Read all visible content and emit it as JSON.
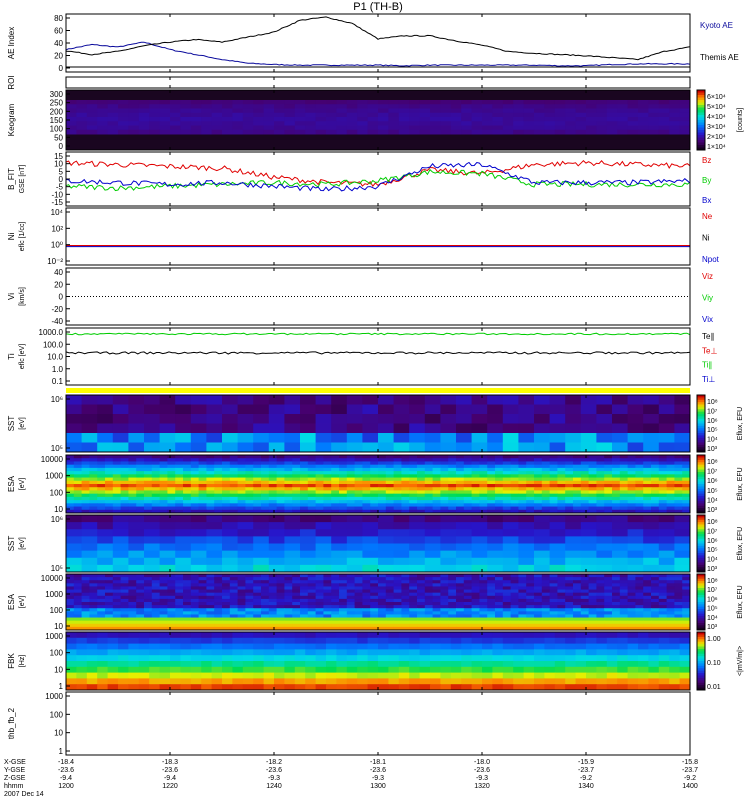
{
  "title": "P1  (TH-B)",
  "colors": {
    "kyoto": "#0a0a9c",
    "themis": "#000000",
    "red": "#e00000",
    "green": "#00cc00",
    "blue": "#0000cc",
    "label": "#000000"
  },
  "footer": {
    "row_labels": [
      "X-GSE",
      "Y-GSE",
      "Z-GSE",
      "hhmm",
      "2007 Dec 14"
    ],
    "x_gse": [
      "-18.4",
      "-18.3",
      "-18.2",
      "-18.1",
      "-18.0",
      "-15.9",
      "-15.8"
    ],
    "y_gse": [
      "-23.6",
      "-23.6",
      "-23.6",
      "-23.6",
      "-23.6",
      "-23.7",
      "-23.7"
    ],
    "z_gse": [
      "-9.4",
      "-9.4",
      "-9.3",
      "-9.3",
      "-9.3",
      "-9.2",
      "-9.2"
    ],
    "hhmm": [
      "1200",
      "1220",
      "1240",
      "1300",
      "1320",
      "1340",
      "1400"
    ],
    "date": "2007 Dec 14"
  },
  "chart_data": [
    {
      "type": "line",
      "name": "ae",
      "ylabel": "AE Index",
      "ylim": [
        -8,
        85
      ],
      "yticks": [
        "80",
        "60",
        "40",
        "20",
        "0"
      ],
      "x": [
        0,
        5,
        10,
        15,
        20,
        25,
        30,
        35,
        40,
        45,
        50,
        55,
        60,
        65,
        70,
        75,
        80,
        85,
        90,
        95,
        100,
        105,
        110,
        115,
        120
      ],
      "series": [
        {
          "name": "Kyoto AE",
          "values": [
            28,
            36,
            32,
            40,
            28,
            20,
            12,
            6,
            4,
            3,
            3,
            3,
            3,
            2,
            3,
            3,
            3,
            3,
            3,
            2,
            2,
            4,
            5,
            5,
            5
          ]
        },
        {
          "name": "Themis AE",
          "values": [
            26,
            20,
            25,
            34,
            40,
            44,
            40,
            48,
            56,
            75,
            80,
            70,
            45,
            50,
            50,
            42,
            35,
            25,
            22,
            20,
            18,
            15,
            12,
            25,
            32
          ]
        }
      ],
      "legend": [
        "Kyoto AE",
        "Themis AE"
      ]
    },
    {
      "type": "heatmap",
      "name": "roi",
      "ylabel": "ROI",
      "yticks": []
    },
    {
      "type": "heatmap",
      "name": "keogram",
      "ylabel": "Keogram",
      "yticks": [
        "300",
        "250",
        "200",
        "150",
        "100",
        "50",
        "0"
      ],
      "colorbar": {
        "label": "[counts]",
        "ticks": [
          "6×10⁴",
          "5×10⁴",
          "4×10⁴",
          "3×10⁴",
          "2×10⁴",
          "1×10⁴"
        ]
      }
    },
    {
      "type": "line",
      "name": "bfield",
      "ylabel": "B_FIT",
      "units": "GSE [nT]",
      "ylim": [
        -15,
        15
      ],
      "yticks": [
        "15",
        "10",
        "5",
        "0",
        "-5",
        "-10",
        "-15"
      ],
      "x": [
        0,
        10,
        20,
        30,
        40,
        50,
        60,
        70,
        80,
        90,
        100,
        110,
        120
      ],
      "series": [
        {
          "name": "Bz",
          "values": [
            9,
            8,
            7,
            6,
            1,
            -2,
            -3,
            5,
            3,
            8,
            9,
            8,
            7
          ]
        },
        {
          "name": "By",
          "values": [
            -4,
            -5,
            -4,
            -3,
            -2,
            -3,
            -1,
            4,
            3,
            -3,
            -3,
            -3,
            -3
          ]
        },
        {
          "name": "Bx",
          "values": [
            -1,
            -2,
            -3,
            -2,
            -4,
            -6,
            -4,
            7,
            8,
            -2,
            -2,
            -2,
            -1
          ]
        }
      ],
      "legend": [
        "Bz",
        "By",
        "Bx"
      ]
    },
    {
      "type": "line",
      "name": "density",
      "ylabel": "Ni",
      "units": "eflc [1/cc]",
      "yticks": [
        "10⁴",
        "10²",
        "10⁰",
        "10⁻²"
      ],
      "legend": [
        "Ne",
        "Ni",
        "Npot"
      ],
      "value_level": 1
    },
    {
      "type": "line",
      "name": "velocity",
      "ylabel": "Vi",
      "units": "[km/s]",
      "yticks": [
        "40",
        "20",
        "0",
        "-20",
        "-40"
      ],
      "legend": [
        "Viz",
        "Viy",
        "Vix"
      ]
    },
    {
      "type": "line",
      "name": "temperature",
      "ylabel": "Ti",
      "units": "eflc [eV]",
      "yticks": [
        "1000.0",
        "100.0",
        "10.0",
        "1.0",
        "0.1"
      ],
      "series": [
        {
          "name": "Ti∥",
          "level": 700
        },
        {
          "name": "Te∥",
          "level": 20
        }
      ],
      "legend": [
        "Te∥",
        "Te⊥",
        "Ti∥",
        "Ti⊥"
      ]
    },
    {
      "type": "heatmap",
      "name": "sst1",
      "ylabel": "SST",
      "units": "[eV]",
      "yticks": [
        "10⁶",
        "10⁵"
      ],
      "colorbar": {
        "label": "Eflux, EFU",
        "ticks": [
          "10⁸",
          "10⁷",
          "10⁶",
          "10⁵",
          "10⁴",
          "10³"
        ]
      }
    },
    {
      "type": "heatmap",
      "name": "esa1",
      "ylabel": "ESA",
      "units": "[eV]",
      "yticks": [
        "10000",
        "1000",
        "100",
        "10"
      ],
      "colorbar": {
        "label": "Eflux, EFU",
        "ticks": [
          "10⁸",
          "10⁷",
          "10⁶",
          "10⁵",
          "10⁴",
          "10³"
        ]
      }
    },
    {
      "type": "heatmap",
      "name": "sst2",
      "ylabel": "SST",
      "units": "[eV]",
      "yticks": [
        "10⁶",
        "10⁵"
      ],
      "colorbar": {
        "label": "Eflux, EFU",
        "ticks": [
          "10⁸",
          "10⁷",
          "10⁶",
          "10⁵",
          "10⁴",
          "10³"
        ]
      }
    },
    {
      "type": "heatmap",
      "name": "esa2",
      "ylabel": "ESA",
      "units": "[eV]",
      "yticks": [
        "10000",
        "1000",
        "100",
        "10"
      ],
      "colorbar": {
        "label": "Eflux, EFU",
        "ticks": [
          "10⁸",
          "10⁷",
          "10⁶",
          "10⁵",
          "10⁴",
          "10³"
        ]
      }
    },
    {
      "type": "heatmap",
      "name": "fbk",
      "ylabel": "FBK",
      "units": "[Hz]",
      "yticks": [
        "1000",
        "100",
        "10",
        "1"
      ],
      "colorbar": {
        "label": "<|mV/m|>",
        "ticks": [
          "1.00",
          "0.10",
          "0.01"
        ]
      }
    },
    {
      "type": "line",
      "name": "fb2",
      "ylabel": "thb_fb_2",
      "yticks": [
        "1000",
        "100",
        "10",
        "1"
      ]
    }
  ]
}
